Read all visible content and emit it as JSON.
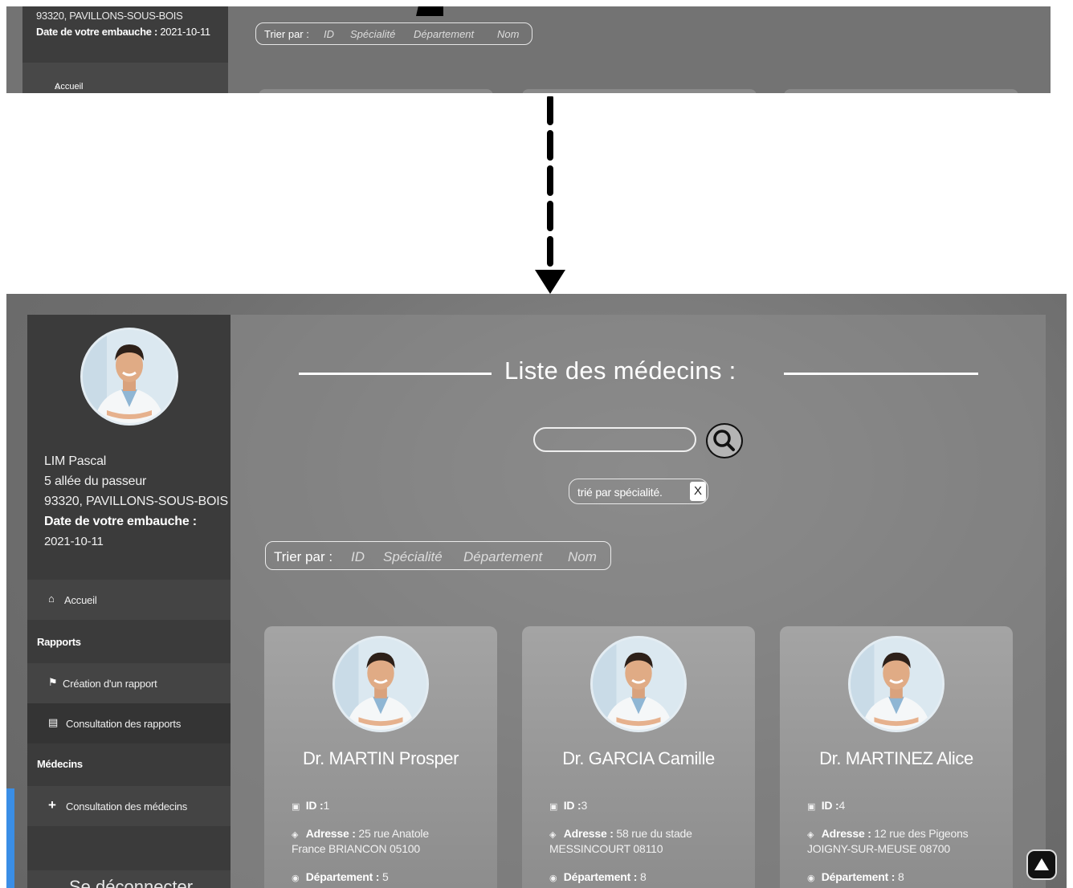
{
  "top_crop": {
    "address_line": "93320, PAVILLONS-SOUS-BOIS",
    "hire_label": "Date de votre embauche :",
    "hire_date": "2021-10-11",
    "nav_home": "Accueil",
    "sort": {
      "label": "Trier par :",
      "options": [
        "ID",
        "Spécialité",
        "Département",
        "Nom"
      ]
    }
  },
  "bottom": {
    "profile": {
      "name": "LIM Pascal",
      "street": "5 allée du passeur",
      "city": "93320, PAVILLONS-SOUS-BOIS",
      "hire_label": "Date de votre embauche :",
      "hire_date": "2021-10-11"
    },
    "sidebar": {
      "home": "Accueil",
      "section_reports": "Rapports",
      "create_report": "Création d'un rapport",
      "view_reports": "Consultation des rapports",
      "section_doctors": "Médecins",
      "view_doctors": "Consultation des médecins",
      "logout": "Se déconnecter"
    },
    "page_title": "Liste des médecins :",
    "search": {
      "value": "",
      "placeholder": ""
    },
    "active_sort_chip": {
      "label": "trié par spécialité.",
      "remove": "X"
    },
    "sort": {
      "label": "Trier par :",
      "options": [
        "ID",
        "Spécialité",
        "Département",
        "Nom"
      ]
    },
    "cards": [
      {
        "name": "Dr. MARTIN Prosper",
        "id_label": "ID :",
        "id": "1",
        "address_label": "Adresse :",
        "address_1": "25 rue Anatole",
        "address_2": "France BRIANCON 05100",
        "dept_label": "Département :",
        "dept": "5"
      },
      {
        "name": "Dr. GARCIA Camille",
        "id_label": "ID :",
        "id": "3",
        "address_label": "Adresse :",
        "address_1": "58 rue du stade",
        "address_2": "MESSINCOURT 08110",
        "dept_label": "Département :",
        "dept": "8"
      },
      {
        "name": "Dr. MARTINEZ Alice",
        "id_label": "ID :",
        "id": "4",
        "address_label": "Adresse :",
        "address_1": "12 rue des Pigeons",
        "address_2": "JOIGNY-SUR-MEUSE 08700",
        "dept_label": "Département :",
        "dept": "8"
      }
    ]
  },
  "colors": {
    "sidebar_bg": "#3b3b3b",
    "panel_bg": "#7a7a7a",
    "card_bg": "#9a9a9a",
    "text": "#ffffff",
    "arrow": "#000000"
  }
}
